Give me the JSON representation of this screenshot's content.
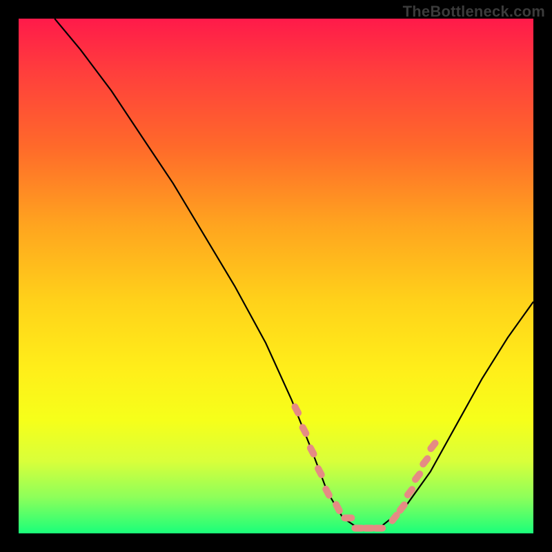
{
  "watermark": "TheBottleneck.com",
  "chart_data": {
    "type": "line",
    "title": "",
    "xlabel": "",
    "ylabel": "",
    "xlim": [
      0,
      100
    ],
    "ylim": [
      0,
      100
    ],
    "grid": false,
    "legend": false,
    "series": [
      {
        "name": "bottleneck-curve",
        "color": "#000000",
        "x": [
          7,
          12,
          18,
          24,
          30,
          36,
          42,
          48,
          53,
          57,
          60,
          63,
          66,
          70,
          75,
          80,
          85,
          90,
          95,
          100
        ],
        "y": [
          100,
          94,
          86,
          77,
          68,
          58,
          48,
          37,
          26,
          16,
          8,
          3,
          1,
          1,
          5,
          12,
          21,
          30,
          38,
          45
        ]
      },
      {
        "name": "point-markers",
        "color": "#e58b84",
        "type": "scatter",
        "x": [
          54,
          55.5,
          57,
          58.5,
          60,
          62,
          64,
          66,
          68,
          70,
          73,
          74.5,
          76,
          77.5,
          79,
          80.5
        ],
        "y": [
          24,
          20,
          16,
          12,
          8,
          5,
          3,
          1,
          1,
          1,
          3,
          5,
          8,
          11,
          14,
          17
        ]
      }
    ],
    "annotations": []
  }
}
